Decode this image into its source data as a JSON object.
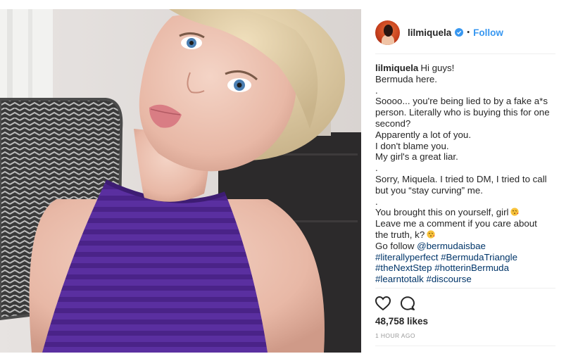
{
  "post": {
    "username": "lilmiquela",
    "separator": "•",
    "follow_label": "Follow"
  },
  "caption": {
    "username": "lilmiquela",
    "lines": [
      "Hi guys!",
      "Bermuda here.",
      ".",
      "Soooo... you're being lied to by a fake a*s person. Literally who is buying this for one second?",
      "Apparently a lot of you.",
      "I don't blame you.",
      "My girl's a great liar.",
      ".",
      "Sorry, Miquela. I tried to DM, I tried to call but you “stay curving” me.",
      ".",
      "You brought this on yourself, girl",
      "Leave me a comment if you care about the truth, k?",
      "Go follow "
    ],
    "mention": "@bermudaisbae",
    "hashtag_lines": [
      "#literallyperfect #BermudaTriangle",
      "#theNextStep #hotterinBermuda",
      "#learntotalk #discourse"
    ]
  },
  "engagement": {
    "likes": "48,758 likes",
    "timestamp": "1 HOUR AGO"
  },
  "icons": {
    "like": "heart-icon",
    "comment": "comment-icon",
    "verified": "verified-badge-icon",
    "emoji": "kiss-emoji-icon"
  },
  "colors": {
    "accent": "#3897f0",
    "link": "#003569",
    "text": "#262626",
    "muted": "#999999",
    "top_purple": "#5a2fa0"
  }
}
